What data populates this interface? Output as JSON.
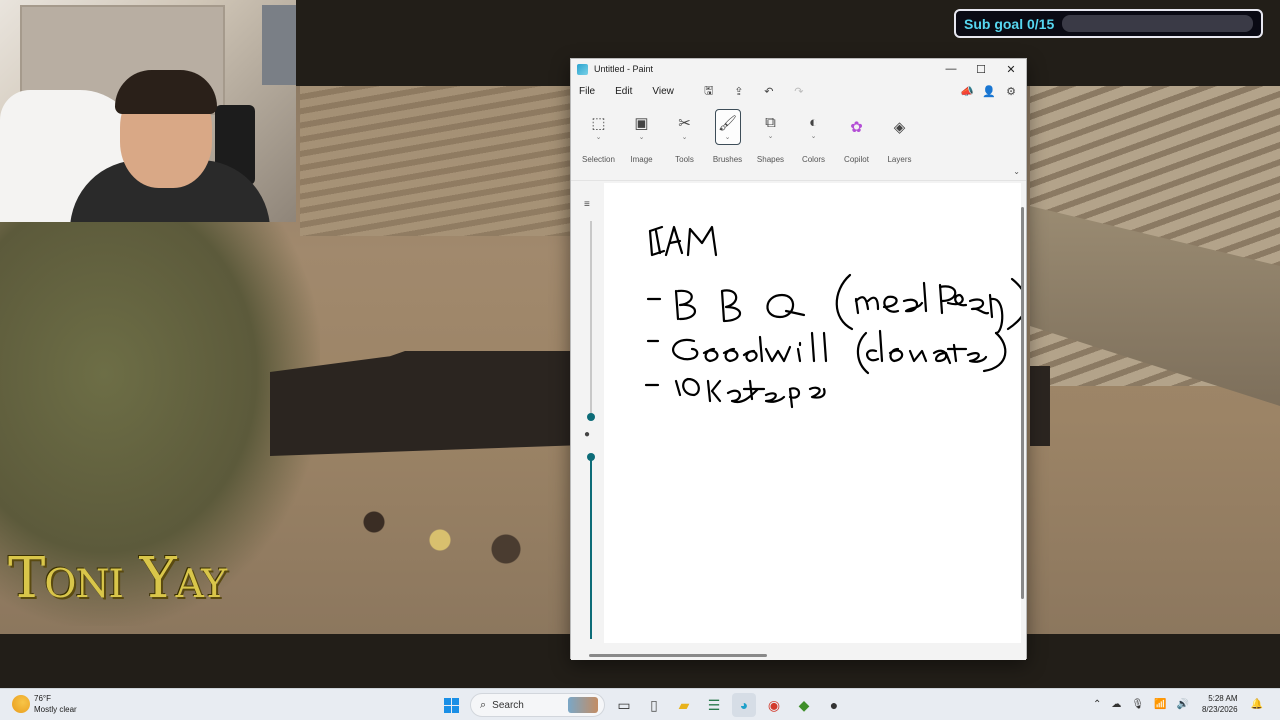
{
  "overlay": {
    "subgoal_label": "Sub goal 0/15",
    "progress_fraction": 0.0,
    "accent_color": "#56d6f0"
  },
  "watermark": {
    "text": "Toni Yay"
  },
  "paint": {
    "title": "Untitled - Paint",
    "window_controls": {
      "minimize": "—",
      "maximize": "☐",
      "close": "✕"
    },
    "menu": {
      "file": "File",
      "edit": "Edit",
      "view": "View"
    },
    "menu_icons": {
      "save": "🖫",
      "share": "⇪",
      "undo": "↶",
      "redo": "↷"
    },
    "ribbon": [
      {
        "label": "Selection",
        "icon": "selection-icon",
        "glyph": "⬚"
      },
      {
        "label": "Image",
        "icon": "image-icon",
        "glyph": "▣"
      },
      {
        "label": "Tools",
        "icon": "tools-icon",
        "glyph": "✂"
      },
      {
        "label": "Brushes",
        "icon": "brush-icon",
        "glyph": "🖌"
      },
      {
        "label": "Shapes",
        "icon": "shapes-icon",
        "glyph": "⧉"
      },
      {
        "label": "Colors",
        "icon": "palette-icon",
        "glyph": "◐"
      },
      {
        "label": "Copilot",
        "icon": "copilot-icon",
        "glyph": "✿"
      },
      {
        "label": "Layers",
        "icon": "layers-icon",
        "glyph": "◈"
      }
    ],
    "active_tool": "Brushes",
    "canvas_handwriting": [
      "SAM",
      "- BBQ (meal Prep)",
      "- Goodwill (donate)",
      "- 10k steps"
    ]
  },
  "taskbar": {
    "weather": {
      "temp": "76°F",
      "condition": "Mostly clear"
    },
    "search_placeholder": "Search",
    "time": "5:28 AM",
    "date": "8/23/2026",
    "notification_count": "1"
  }
}
